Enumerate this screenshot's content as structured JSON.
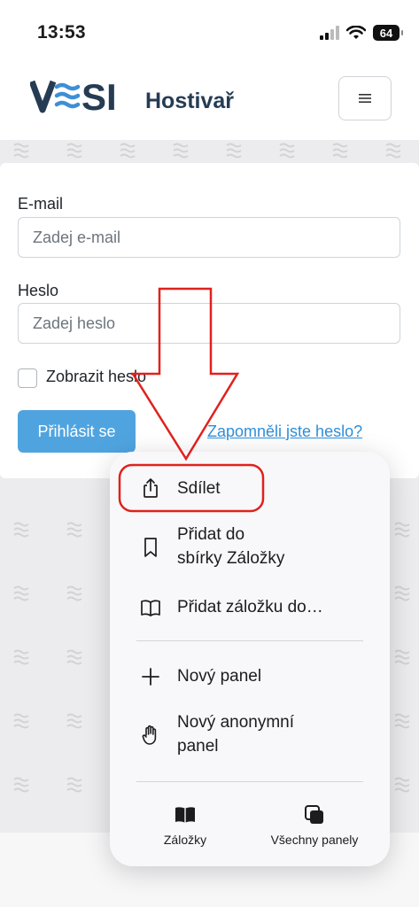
{
  "status": {
    "time": "13:53",
    "battery": "64"
  },
  "header": {
    "logo": "V SI",
    "subtitle": "Hostivař"
  },
  "form": {
    "email_label": "E-mail",
    "email_placeholder": "Zadej e-mail",
    "password_label": "Heslo",
    "password_placeholder": "Zadej heslo",
    "show_password": "Zobrazit heslo",
    "login_button": "Přihlásit se",
    "forgot_link": "Zapomněli jste heslo?"
  },
  "menu": {
    "share": "Sdílet",
    "add_bookmarks_line1": "Přidat do",
    "add_bookmarks_line2": "sbírky Záložky",
    "add_bookmark": "Přidat záložku do…",
    "new_tab": "Nový panel",
    "new_private_line1": "Nový anonymní",
    "new_private_line2": "panel",
    "bookmarks": "Záložky",
    "all_tabs": "Všechny panely"
  },
  "colors": {
    "annotation": "#e0211d",
    "logo": "#253c54",
    "logo_waves": "#3d8fd6",
    "primary": "#4fa4e0"
  }
}
